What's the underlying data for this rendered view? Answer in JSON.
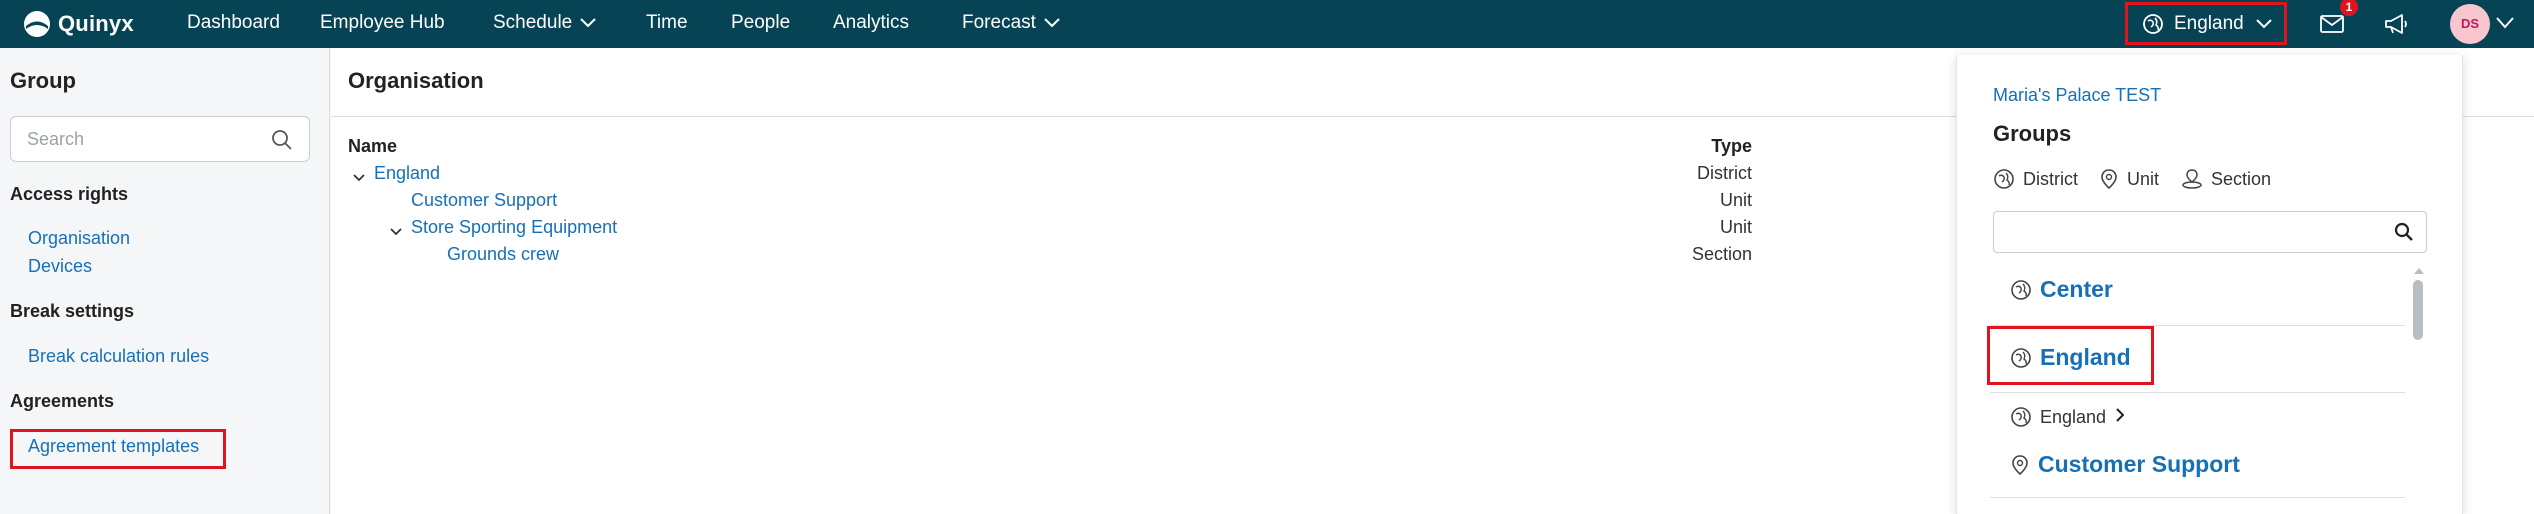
{
  "topbar": {
    "brand": "Quinyx",
    "nav": [
      {
        "label": "Dashboard"
      },
      {
        "label": "Employee Hub"
      },
      {
        "label": "Schedule"
      },
      {
        "label": "Time"
      },
      {
        "label": "People"
      },
      {
        "label": "Analytics"
      },
      {
        "label": "Forecast"
      }
    ],
    "unit_selector": "England",
    "notifications_count": "1",
    "avatar_initials": "DS"
  },
  "sidebar": {
    "title": "Group",
    "search_placeholder": "Search",
    "sections": [
      {
        "heading": "Access rights",
        "items": [
          "Organisation",
          "Devices"
        ]
      },
      {
        "heading": "Break settings",
        "items": [
          "Break calculation rules"
        ]
      },
      {
        "heading": "Agreements",
        "items": [
          "Agreement templates"
        ]
      }
    ]
  },
  "main": {
    "title": "Organisation",
    "columns": {
      "name": "Name",
      "type": "Type"
    },
    "rows": [
      {
        "name": "England",
        "type": "District"
      },
      {
        "name": "Customer Support",
        "type": "Unit"
      },
      {
        "name": "Store Sporting Equipment",
        "type": "Unit"
      },
      {
        "name": "Grounds crew",
        "type": "Section"
      }
    ]
  },
  "dropdown": {
    "context": "Maria's Palace TEST",
    "title": "Groups",
    "legend": [
      "District",
      "Unit",
      "Section"
    ],
    "search_value": "",
    "options": [
      {
        "label": "Center",
        "kind": "district-icon"
      },
      {
        "label": "England",
        "kind": "district-icon"
      },
      {
        "label": "England",
        "kind": "district-icon"
      },
      {
        "label": "Customer Support",
        "kind": "unit-icon"
      }
    ]
  },
  "colors": {
    "topbar": "#064354",
    "link": "#1670b8",
    "highlight": "#e0141e",
    "badge": "#e0141e"
  }
}
